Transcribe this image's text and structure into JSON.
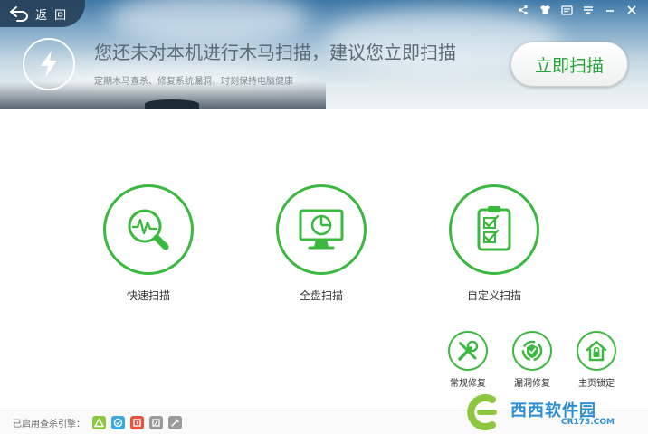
{
  "header": {
    "back_label": "返 回",
    "headline": "您还未对本机进行木马扫描，建议您立即扫描",
    "subline": "定期木马查杀、修复系统漏洞，时刻保持电脑健康",
    "scan_now_label": "立即扫描",
    "window_controls": [
      "share-icon",
      "skin-icon",
      "message-icon",
      "menu-icon",
      "minimize-icon",
      "close-icon"
    ]
  },
  "scan_options": [
    {
      "label": "快速扫描",
      "icon": "quick-scan-icon"
    },
    {
      "label": "全盘扫描",
      "icon": "full-scan-icon"
    },
    {
      "label": "自定义扫描",
      "icon": "custom-scan-icon"
    }
  ],
  "tools": [
    {
      "label": "常规修复",
      "icon": "repair-icon"
    },
    {
      "label": "漏洞修复",
      "icon": "vulnerability-icon"
    },
    {
      "label": "主页锁定",
      "icon": "homepage-lock-icon"
    }
  ],
  "footer": {
    "engines_label": "已启用查杀引擎：",
    "engines": [
      {
        "name": "cloud-engine-icon",
        "color": "#8dc63f"
      },
      {
        "name": "qvm-engine-icon",
        "color": "#3aa9e0"
      },
      {
        "name": "avira-engine-icon",
        "color": "#e8523f"
      },
      {
        "name": "bitdefender-engine-icon",
        "color": "#9a9a9a"
      },
      {
        "name": "repair-engine-icon",
        "color": "#9a9a9a"
      }
    ]
  },
  "watermark": {
    "text": "西西软件园",
    "url": "CR173.COM"
  },
  "colors": {
    "accent": "#3bb83f",
    "button_text": "#27a33a",
    "header_dark": "#233c55"
  }
}
